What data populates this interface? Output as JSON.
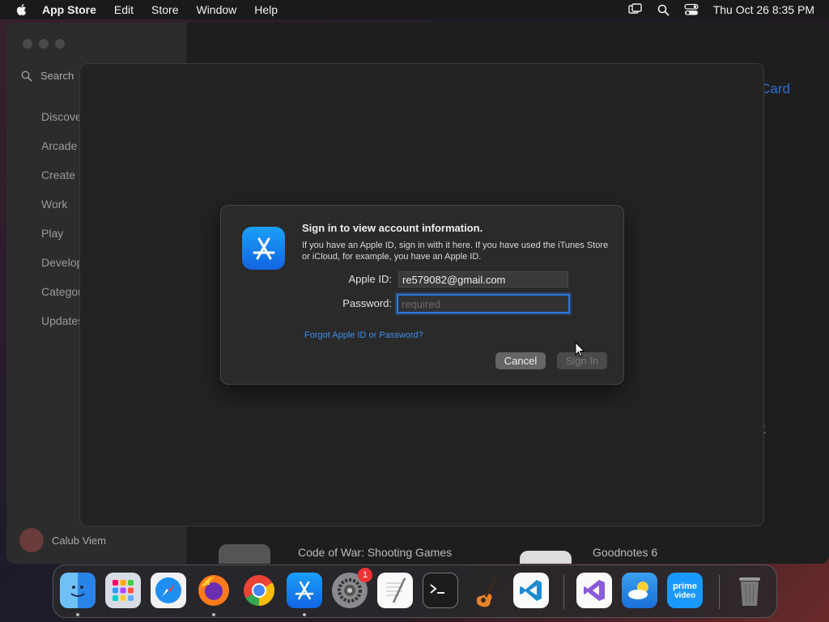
{
  "menubar": {
    "app_name": "App Store",
    "items": [
      "Edit",
      "Store",
      "Window",
      "Help"
    ],
    "clock": "Thu Oct 26  8:35 PM"
  },
  "sidebar": {
    "search_placeholder": "Search",
    "items": [
      "Discover",
      "Arcade",
      "Create",
      "Work",
      "Play",
      "Develop",
      "Categories",
      "Updates"
    ],
    "user_name": "Calub Viem"
  },
  "main": {
    "ghost_link": "Card",
    "ghost_k": "K",
    "app_left": "Code of War: Shooting Games",
    "app_right": "Goodnotes 6"
  },
  "dialog": {
    "title": "Sign in to view account information.",
    "description": "If you have an Apple ID, sign in with it here. If you have used the iTunes Store or iCloud, for example, you have an Apple ID.",
    "apple_id_label": "Apple ID:",
    "apple_id_value": "re579082@gmail.com",
    "password_label": "Password:",
    "password_placeholder": "required",
    "forgot_link": "Forgot Apple ID or Password?",
    "cancel_label": "Cancel",
    "signin_label": "Sign In"
  },
  "dock": {
    "settings_badge": "1",
    "apps": [
      "Finder",
      "Launchpad",
      "Safari",
      "Firefox",
      "Chrome",
      "App Store",
      "System Settings",
      "TextEdit",
      "Terminal",
      "GarageBand",
      "Visual Studio Code",
      "Visual Studio",
      "Weather",
      "Prime Video",
      "Trash"
    ]
  },
  "colors": {
    "accent": "#2a79d6",
    "link": "#3a8ee6",
    "badge": "#e33333"
  }
}
